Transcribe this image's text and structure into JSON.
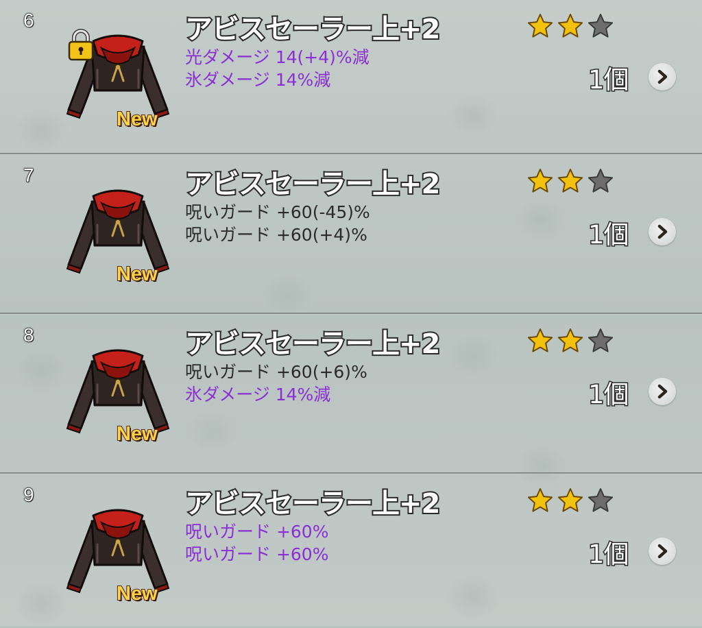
{
  "new_label": "New",
  "colors": {
    "effect_purple": "#8a2fd6",
    "effect_dark": "#2b2b2b",
    "star_filled": "#f3c20f",
    "star_empty": "#6d6d6d"
  },
  "items": [
    {
      "index": "6",
      "name": "アビスセーラー上+2",
      "locked": true,
      "is_new": true,
      "rating": 2,
      "rating_max": 3,
      "effects": [
        {
          "text": "光ダメージ  14(+4)%減",
          "color": "purple"
        },
        {
          "text": "氷ダメージ  14%減",
          "color": "purple"
        }
      ],
      "count": "1個",
      "icon": "robe-icon"
    },
    {
      "index": "7",
      "name": "アビスセーラー上+2",
      "locked": false,
      "is_new": true,
      "rating": 2,
      "rating_max": 3,
      "effects": [
        {
          "text": "呪いガード  +60(-45)%",
          "color": "dark"
        },
        {
          "text": "呪いガード  +60(+4)%",
          "color": "dark"
        }
      ],
      "count": "1個",
      "icon": "robe-icon"
    },
    {
      "index": "8",
      "name": "アビスセーラー上+2",
      "locked": false,
      "is_new": true,
      "rating": 2,
      "rating_max": 3,
      "effects": [
        {
          "text": "呪いガード  +60(+6)%",
          "color": "dark"
        },
        {
          "text": "氷ダメージ  14%減",
          "color": "purple"
        }
      ],
      "count": "1個",
      "icon": "robe-icon"
    },
    {
      "index": "9",
      "name": "アビスセーラー上+2",
      "locked": false,
      "is_new": true,
      "rating": 2,
      "rating_max": 3,
      "effects": [
        {
          "text": "呪いガード  +60%",
          "color": "purple"
        },
        {
          "text": "呪いガード  +60%",
          "color": "purple"
        }
      ],
      "count": "1個",
      "icon": "robe-icon"
    }
  ]
}
